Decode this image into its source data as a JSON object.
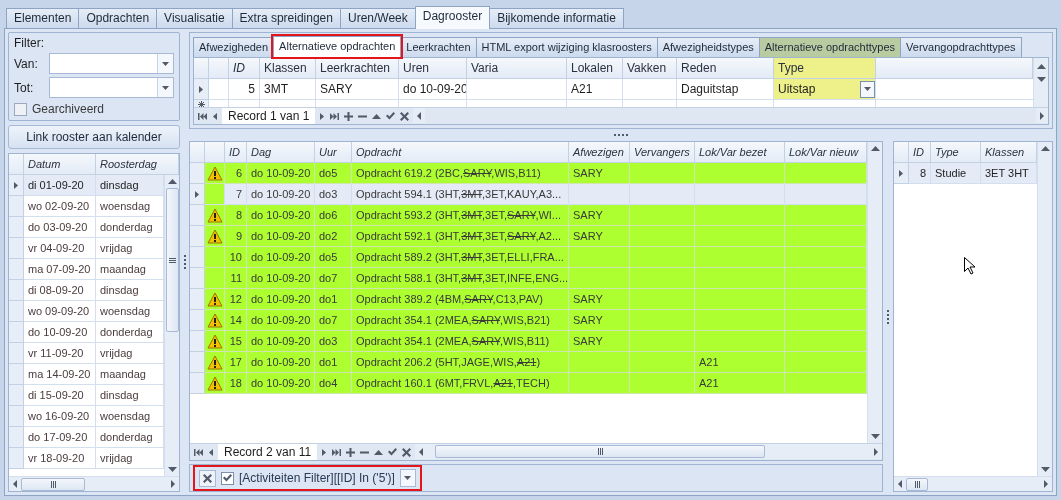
{
  "tabs": [
    {
      "label": "Elementen",
      "selected": false
    },
    {
      "label": "Opdrachten",
      "selected": false
    },
    {
      "label": "Visualisatie",
      "selected": false
    },
    {
      "label": "Extra spreidingen",
      "selected": false
    },
    {
      "label": "Uren/Week",
      "selected": false
    },
    {
      "label": "Dagrooster",
      "selected": true
    },
    {
      "label": "Bijkomende informatie",
      "selected": false
    }
  ],
  "filter": {
    "title": "Filter:",
    "van_label": "Van:",
    "tot_label": "Tot:",
    "archived": {
      "label": "Gearchiveerd",
      "checked": false
    },
    "link_button": "Link rooster aan kalender"
  },
  "date_grid": {
    "columns": [
      "Datum",
      "Roosterdag"
    ],
    "rows": [
      {
        "datum": "di 01-09-20",
        "roosterdag": "dinsdag",
        "selected": true
      },
      {
        "datum": "wo 02-09-20",
        "roosterdag": "woensdag",
        "selected": false
      },
      {
        "datum": "do 03-09-20",
        "roosterdag": "donderdag",
        "selected": false
      },
      {
        "datum": "vr 04-09-20",
        "roosterdag": "vrijdag",
        "selected": false
      },
      {
        "datum": "ma 07-09-20",
        "roosterdag": "maandag",
        "selected": false
      },
      {
        "datum": "di 08-09-20",
        "roosterdag": "dinsdag",
        "selected": false
      },
      {
        "datum": "wo 09-09-20",
        "roosterdag": "woensdag",
        "selected": false
      },
      {
        "datum": "do 10-09-20",
        "roosterdag": "donderdag",
        "selected": false
      },
      {
        "datum": "vr 11-09-20",
        "roosterdag": "vrijdag",
        "selected": false
      },
      {
        "datum": "ma 14-09-20",
        "roosterdag": "maandag",
        "selected": false
      },
      {
        "datum": "di 15-09-20",
        "roosterdag": "dinsdag",
        "selected": false
      },
      {
        "datum": "wo 16-09-20",
        "roosterdag": "woensdag",
        "selected": false
      },
      {
        "datum": "do 17-09-20",
        "roosterdag": "donderdag",
        "selected": false
      },
      {
        "datum": "vr 18-09-20",
        "roosterdag": "vrijdag",
        "selected": false
      }
    ]
  },
  "sub_tabs": [
    {
      "label": "Afwezigheden",
      "selected": false,
      "highlighted": false,
      "tinted": false
    },
    {
      "label": "Alternatieve opdrachten",
      "selected": true,
      "highlighted": true,
      "tinted": false
    },
    {
      "label": "Leerkrachten",
      "selected": false,
      "highlighted": false,
      "tinted": false
    },
    {
      "label": "HTML export wijziging klasroosters",
      "selected": false,
      "highlighted": false,
      "tinted": false
    },
    {
      "label": "Afwezigheidstypes",
      "selected": false,
      "highlighted": false,
      "tinted": false
    },
    {
      "label": "Alternatieve opdrachttypes",
      "selected": false,
      "highlighted": false,
      "tinted": true
    },
    {
      "label": "Vervangopdrachttypes",
      "selected": false,
      "highlighted": false,
      "tinted": false
    }
  ],
  "top_grid": {
    "columns": [
      {
        "label": "ID",
        "focused": false
      },
      {
        "label": "Klassen",
        "focused": false
      },
      {
        "label": "Leerkrachten",
        "focused": false
      },
      {
        "label": "Uren",
        "focused": false
      },
      {
        "label": "Varia",
        "focused": false
      },
      {
        "label": "Lokalen",
        "focused": false
      },
      {
        "label": "Vakken",
        "focused": false
      },
      {
        "label": "Reden",
        "focused": false
      },
      {
        "label": "Type",
        "focused": true
      }
    ],
    "rows": [
      {
        "selected": true,
        "cells": [
          "5",
          "3MT",
          "SARY",
          "do 10-09-20",
          null,
          "A21",
          null,
          "Daguitstap",
          "Uitstap"
        ]
      }
    ],
    "navigator": "Record 1 van 1"
  },
  "main_grid": {
    "columns": [
      "ID",
      "Dag",
      "Uur",
      "Opdracht",
      "Afwezigen",
      "Vervangers",
      "Lok/Var bezet",
      "Lok/Var nieuw"
    ],
    "rows": [
      {
        "warning": true,
        "selected": false,
        "id": "6",
        "dag": "do 10-09-20",
        "uur": "do5",
        "opdracht": [
          {
            "text": "Opdracht 619.2 (2BC,",
            "struck": false
          },
          {
            "text": "SARY",
            "struck": true
          },
          {
            "text": ",WIS,B11)",
            "struck": false
          }
        ],
        "afwezigen": "SARY"
      },
      {
        "warning": false,
        "selected": true,
        "id": "7",
        "dag": "do 10-09-20",
        "uur": "do3",
        "opdracht": [
          {
            "text": "Opdracht 594.1 (3HT,",
            "struck": false
          },
          {
            "text": "3MT",
            "struck": true
          },
          {
            "text": ",3ET,KAUY,A3...",
            "struck": false
          }
        ]
      },
      {
        "warning": true,
        "selected": false,
        "id": "8",
        "dag": "do 10-09-20",
        "uur": "do6",
        "opdracht": [
          {
            "text": "Opdracht 593.2 (3HT,",
            "struck": false
          },
          {
            "text": "3MT",
            "struck": true
          },
          {
            "text": ",3ET,",
            "struck": false
          },
          {
            "text": "SARY",
            "struck": true
          },
          {
            "text": ",WI...",
            "struck": false
          }
        ],
        "afwezigen": "SARY"
      },
      {
        "warning": true,
        "selected": false,
        "id": "9",
        "dag": "do 10-09-20",
        "uur": "do2",
        "opdracht": [
          {
            "text": "Opdracht 592.1 (3HT,",
            "struck": false
          },
          {
            "text": "3MT",
            "struck": true
          },
          {
            "text": ",3ET,",
            "struck": false
          },
          {
            "text": "SARY",
            "struck": true
          },
          {
            "text": ",A2...",
            "struck": false
          }
        ],
        "afwezigen": "SARY"
      },
      {
        "warning": false,
        "selected": false,
        "id": "10",
        "dag": "do 10-09-20",
        "uur": "do5",
        "opdracht": [
          {
            "text": "Opdracht 589.2 (3HT,",
            "struck": false
          },
          {
            "text": "3MT",
            "struck": true
          },
          {
            "text": ",3ET,ELLI,FRA...",
            "struck": false
          }
        ]
      },
      {
        "warning": false,
        "selected": false,
        "id": "11",
        "dag": "do 10-09-20",
        "uur": "do7",
        "opdracht": [
          {
            "text": "Opdracht 588.1 (3HT,",
            "struck": false
          },
          {
            "text": "3MT",
            "struck": true
          },
          {
            "text": ",3ET,INFE,ENG...",
            "struck": false
          }
        ]
      },
      {
        "warning": true,
        "selected": false,
        "id": "12",
        "dag": "do 10-09-20",
        "uur": "do1",
        "opdracht": [
          {
            "text": "Opdracht 389.2 (4BM,",
            "struck": false
          },
          {
            "text": "SARY",
            "struck": true
          },
          {
            "text": ",C13,PAV)",
            "struck": false
          }
        ],
        "afwezigen": "SARY"
      },
      {
        "warning": true,
        "selected": false,
        "id": "14",
        "dag": "do 10-09-20",
        "uur": "do7",
        "opdracht": [
          {
            "text": "Opdracht 354.1 (2MEA,",
            "struck": false
          },
          {
            "text": "SARY",
            "struck": true
          },
          {
            "text": ",WIS,B21)",
            "struck": false
          }
        ],
        "afwezigen": "SARY"
      },
      {
        "warning": true,
        "selected": false,
        "id": "15",
        "dag": "do 10-09-20",
        "uur": "do3",
        "opdracht": [
          {
            "text": "Opdracht 354.1 (2MEA,",
            "struck": false
          },
          {
            "text": "SARY",
            "struck": true
          },
          {
            "text": ",WIS,B11)",
            "struck": false
          }
        ],
        "afwezigen": "SARY"
      },
      {
        "warning": true,
        "selected": false,
        "id": "17",
        "dag": "do 10-09-20",
        "uur": "do1",
        "opdracht": [
          {
            "text": "Opdracht 206.2 (5HT,JAGE,WIS,",
            "struck": false
          },
          {
            "text": "A21",
            "struck": true
          },
          {
            "text": ")",
            "struck": false
          }
        ],
        "lok_var_bezet": "A21"
      },
      {
        "warning": true,
        "selected": false,
        "id": "18",
        "dag": "do 10-09-20",
        "uur": "do4",
        "opdracht": [
          {
            "text": "Opdracht 160.1 (6MT,FRVL,",
            "struck": false
          },
          {
            "text": "A21",
            "struck": true
          },
          {
            "text": ",TECH)",
            "struck": false
          }
        ],
        "lok_var_bezet": "A21"
      }
    ],
    "navigator": "Record 2 van 11"
  },
  "filter_bar": {
    "enabled": true,
    "highlighted": true,
    "text": "[Activiteiten Filter][[ID] In ('5')]"
  },
  "side_grid": {
    "columns": [
      "ID",
      "Type",
      "Klassen"
    ],
    "rows": [
      {
        "selected": true,
        "cells": [
          "8",
          "Studie",
          "3ET 3HT"
        ]
      }
    ]
  }
}
